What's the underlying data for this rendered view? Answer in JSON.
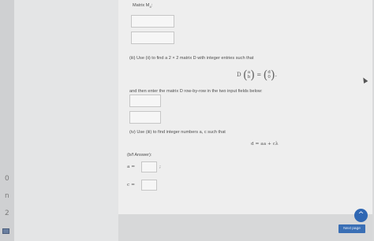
{
  "question": {
    "matrix_label": "Matrix M",
    "matrix_subscript": "4",
    "matrix_colon": ":",
    "part3_text": "(iii) Use (ii) to find a 2 × 2 matrix D with integer entries such that",
    "eq_D": "D",
    "vec_left_top": "a",
    "vec_left_bottom": "b",
    "eq_equals": "=",
    "vec_right_top": "d",
    "vec_right_bottom": "0",
    "eq_period": ".",
    "enter_text": "and then enter the matrix D row-by-row in the two input fields below:",
    "part4_text": "(iv) Use (iii) to find integer numbers a, c such that",
    "eq_d": "d = aa + cλ",
    "answer_label": "(b/f Answer):",
    "a_label": "a =",
    "a_suffix": ";",
    "c_label": "c ="
  },
  "left_marks": [
    "0",
    "n",
    "2"
  ],
  "controls": {
    "scroll_up": "^",
    "next_label": "Next page"
  }
}
